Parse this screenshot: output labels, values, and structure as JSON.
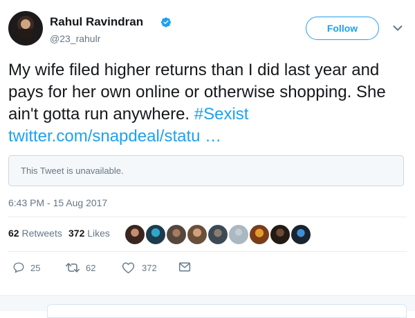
{
  "user": {
    "name": "Rahul Ravindran",
    "handle": "@23_rahulr",
    "verified": true
  },
  "actions": {
    "follow_label": "Follow"
  },
  "tweet": {
    "text_before": "My wife filed higher returns than I did last year and pays for her own online or otherwise shopping. She ain't gotta run anywhere.",
    "hashtag": "#Sexist",
    "link": "twitter.com/snapdeal/statu …",
    "quote_notice": "This Tweet is unavailable.",
    "timestamp": "6:43 PM - 15 Aug 2017"
  },
  "stats": {
    "retweets_count": "62",
    "retweets_label": "Retweets",
    "likes_count": "372",
    "likes_label": "Likes"
  },
  "toolbar": {
    "reply_count": "25",
    "retweet_count": "62",
    "like_count": "372"
  },
  "colors": {
    "accent": "#1da1f2",
    "text": "#14171a",
    "muted": "#657786",
    "verified": "#1da1f2"
  },
  "icons": [
    "verified-badge-icon",
    "chevron-down-icon",
    "reply-icon",
    "retweet-icon",
    "like-icon",
    "message-icon"
  ]
}
